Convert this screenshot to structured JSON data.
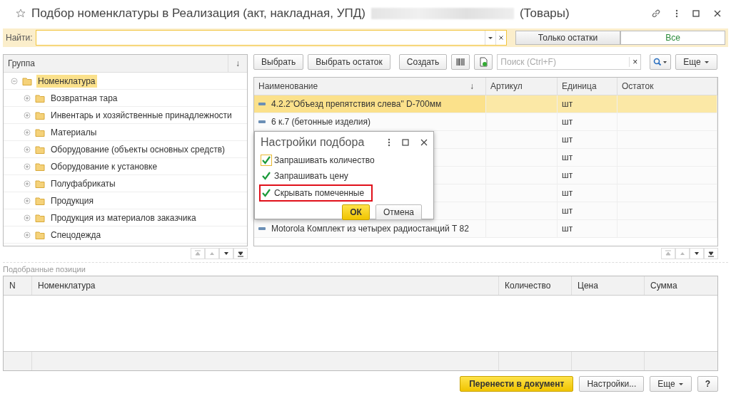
{
  "window": {
    "title": "Подбор номенклатуры в Реализация (акт, накладная, УПД)",
    "title_suffix": "(Товары)"
  },
  "search": {
    "label": "Найти:"
  },
  "filter_tabs": [
    {
      "label": "Только остатки",
      "selected": false
    },
    {
      "label": "Все",
      "selected": true
    }
  ],
  "groups": {
    "column": "Группа",
    "sort_mark": "↓",
    "tree": [
      {
        "label": "Номенклатура",
        "expanded": true,
        "selected": true,
        "children": [
          {
            "label": "Возвратная тара",
            "expanded": false,
            "selected": false
          },
          {
            "label": "Инвентарь и хозяйственные принадлежности",
            "expanded": false,
            "selected": false
          },
          {
            "label": "Материалы",
            "expanded": false,
            "selected": false
          },
          {
            "label": "Оборудование (объекты основных средств)",
            "expanded": false,
            "selected": false
          },
          {
            "label": "Оборудование к установке",
            "expanded": false,
            "selected": false
          },
          {
            "label": "Полуфабрикаты",
            "expanded": false,
            "selected": false
          },
          {
            "label": "Продукция",
            "expanded": false,
            "selected": false
          },
          {
            "label": "Продукция из материалов заказчика",
            "expanded": false,
            "selected": false
          },
          {
            "label": "Спецодежда",
            "expanded": false,
            "selected": false
          }
        ]
      }
    ]
  },
  "toolbar": {
    "buttons": [
      "Выбрать",
      "Выбрать остаток",
      "Создать"
    ],
    "search_placeholder": "Поиск (Ctrl+F)",
    "clear": "×",
    "more": "Еще"
  },
  "products": {
    "columns": [
      "Наименование",
      "Артикул",
      "Единица",
      "Остаток"
    ],
    "sort_mark": "↓",
    "rows": [
      {
        "name": "4.2.2\"Объезд препятствия слева\" D-700мм",
        "unit": "шт",
        "selected": true
      },
      {
        "name": "6 к.7 (бетонные изделия)",
        "unit": "шт",
        "selected": false
      },
      {
        "unit": "шт",
        "selected": false
      },
      {
        "unit": "шт",
        "selected": false
      },
      {
        "unit": "шт",
        "selected": false
      },
      {
        "unit": "шт",
        "selected": false
      },
      {
        "unit": "шт",
        "selected": false
      },
      {
        "name": "Motorola Комплект из четырех радиостанций Т 82",
        "unit": "шт",
        "selected": false
      }
    ]
  },
  "dialog": {
    "title": "Настройки подбора",
    "options": [
      {
        "label": "Запрашивать количество",
        "checked": true,
        "focused": true,
        "highlighted": false
      },
      {
        "label": "Запрашивать цену",
        "checked": true,
        "focused": false,
        "highlighted": false
      },
      {
        "label": "Скрывать помеченные",
        "checked": true,
        "focused": false,
        "highlighted": true
      }
    ],
    "ok": "ОК",
    "cancel": "Отмена"
  },
  "picked": {
    "title": "Подобранные позиции",
    "columns": [
      "N",
      "Номенклатура",
      "Количество",
      "Цена",
      "Сумма"
    ]
  },
  "footer": {
    "transfer": "Перенести в документ",
    "settings": "Настройки...",
    "more": "Еще",
    "help": "?"
  }
}
